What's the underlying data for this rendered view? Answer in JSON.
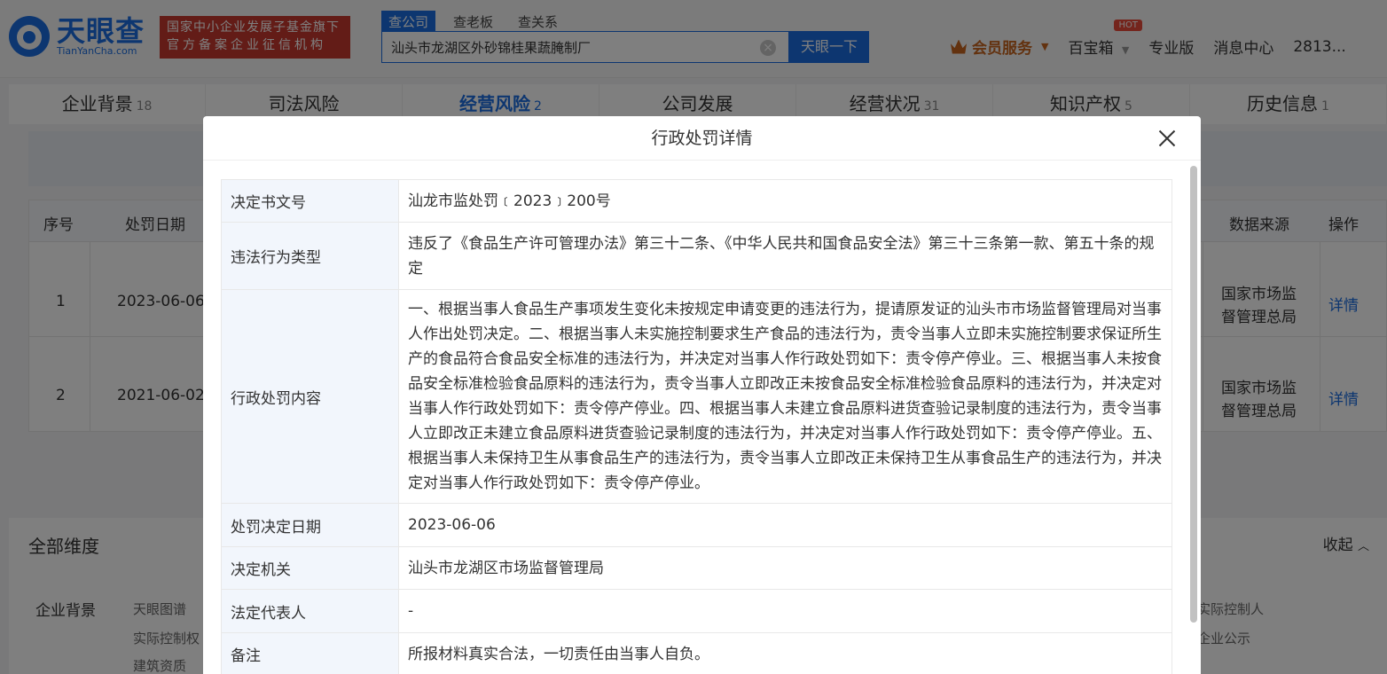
{
  "logo": {
    "cn": "天眼查",
    "en": "TianYanCha.com"
  },
  "badge": {
    "line1": "国家中小企业发展子基金旗下",
    "line2": "官方备案企业征信机构"
  },
  "search": {
    "tabs": [
      "查公司",
      "查老板",
      "查关系"
    ],
    "value": "汕头市龙湖区外砂锦桂果蔬腌制厂",
    "button": "天眼一下"
  },
  "nav": {
    "vip": "会员服务",
    "toolbox": "百宝箱",
    "hot": "HOT",
    "pro": "专业版",
    "messages": "消息中心",
    "user": "2813..."
  },
  "main_tabs": [
    {
      "label": "企业背景",
      "count": "18"
    },
    {
      "label": "司法风险",
      "count": ""
    },
    {
      "label": "经营风险",
      "count": "2"
    },
    {
      "label": "公司发展",
      "count": ""
    },
    {
      "label": "经营状况",
      "count": "31"
    },
    {
      "label": "知识产权",
      "count": "5"
    },
    {
      "label": "历史信息",
      "count": "1"
    }
  ],
  "bg_table": {
    "headers": {
      "no": "序号",
      "date": "处罚日期",
      "source": "数据来源",
      "action": "操作"
    },
    "rows": [
      {
        "no": "1",
        "date": "2023-06-06",
        "source_l1": "国家市场监",
        "source_l2": "督管理总局",
        "action": "详情"
      },
      {
        "no": "2",
        "date": "2021-06-02",
        "source_l1": "国家市场监",
        "source_l2": "督管理总局",
        "action": "详情"
      }
    ]
  },
  "dims": {
    "title": "全部维度",
    "collapse": "收起",
    "category": "企业背景",
    "items": [
      "天眼图谱",
      "实际控制权",
      "建筑资质",
      "实际控制人",
      "企业公示"
    ]
  },
  "modal": {
    "title": "行政处罚详情",
    "rows": [
      {
        "label": "决定书文号",
        "value": "汕龙市监处罚﹝2023﹞200号"
      },
      {
        "label": "违法行为类型",
        "value": "违反了《食品生产许可管理办法》第三十二条、《中华人民共和国食品安全法》第三十三条第一款、第五十条的规定"
      },
      {
        "label": "行政处罚内容",
        "value": "一、根据当事人食品生产事项发生变化未按规定申请变更的违法行为，提请原发证的汕头市市场监督管理局对当事人作出处罚决定。二、根据当事人未实施控制要求生产食品的违法行为，责令当事人立即未实施控制要求保证所生产的食品符合食品安全标准的违法行为，并决定对当事人作行政处罚如下：责令停产停业。三、根据当事人未按食品安全标准检验食品原料的违法行为，责令当事人立即改正未按食品安全标准检验食品原料的违法行为，并决定对当事人作行政处罚如下：责令停产停业。四、根据当事人未建立食品原料进货查验记录制度的违法行为，责令当事人立即改正未建立食品原料进货查验记录制度的违法行为，并决定对当事人作行政处罚如下：责令停产停业。五、根据当事人未保持卫生从事食品生产的违法行为，责令当事人立即改正未保持卫生从事食品生产的违法行为，并决定对当事人作行政处罚如下：责令停产停业。"
      },
      {
        "label": "处罚决定日期",
        "value": "2023-06-06"
      },
      {
        "label": "决定机关",
        "value": "汕头市龙湖区市场监督管理局"
      },
      {
        "label": "法定代表人",
        "value": "-"
      },
      {
        "label": "备注",
        "value": "所报材料真实合法，一切责任由当事人自负。"
      }
    ]
  }
}
